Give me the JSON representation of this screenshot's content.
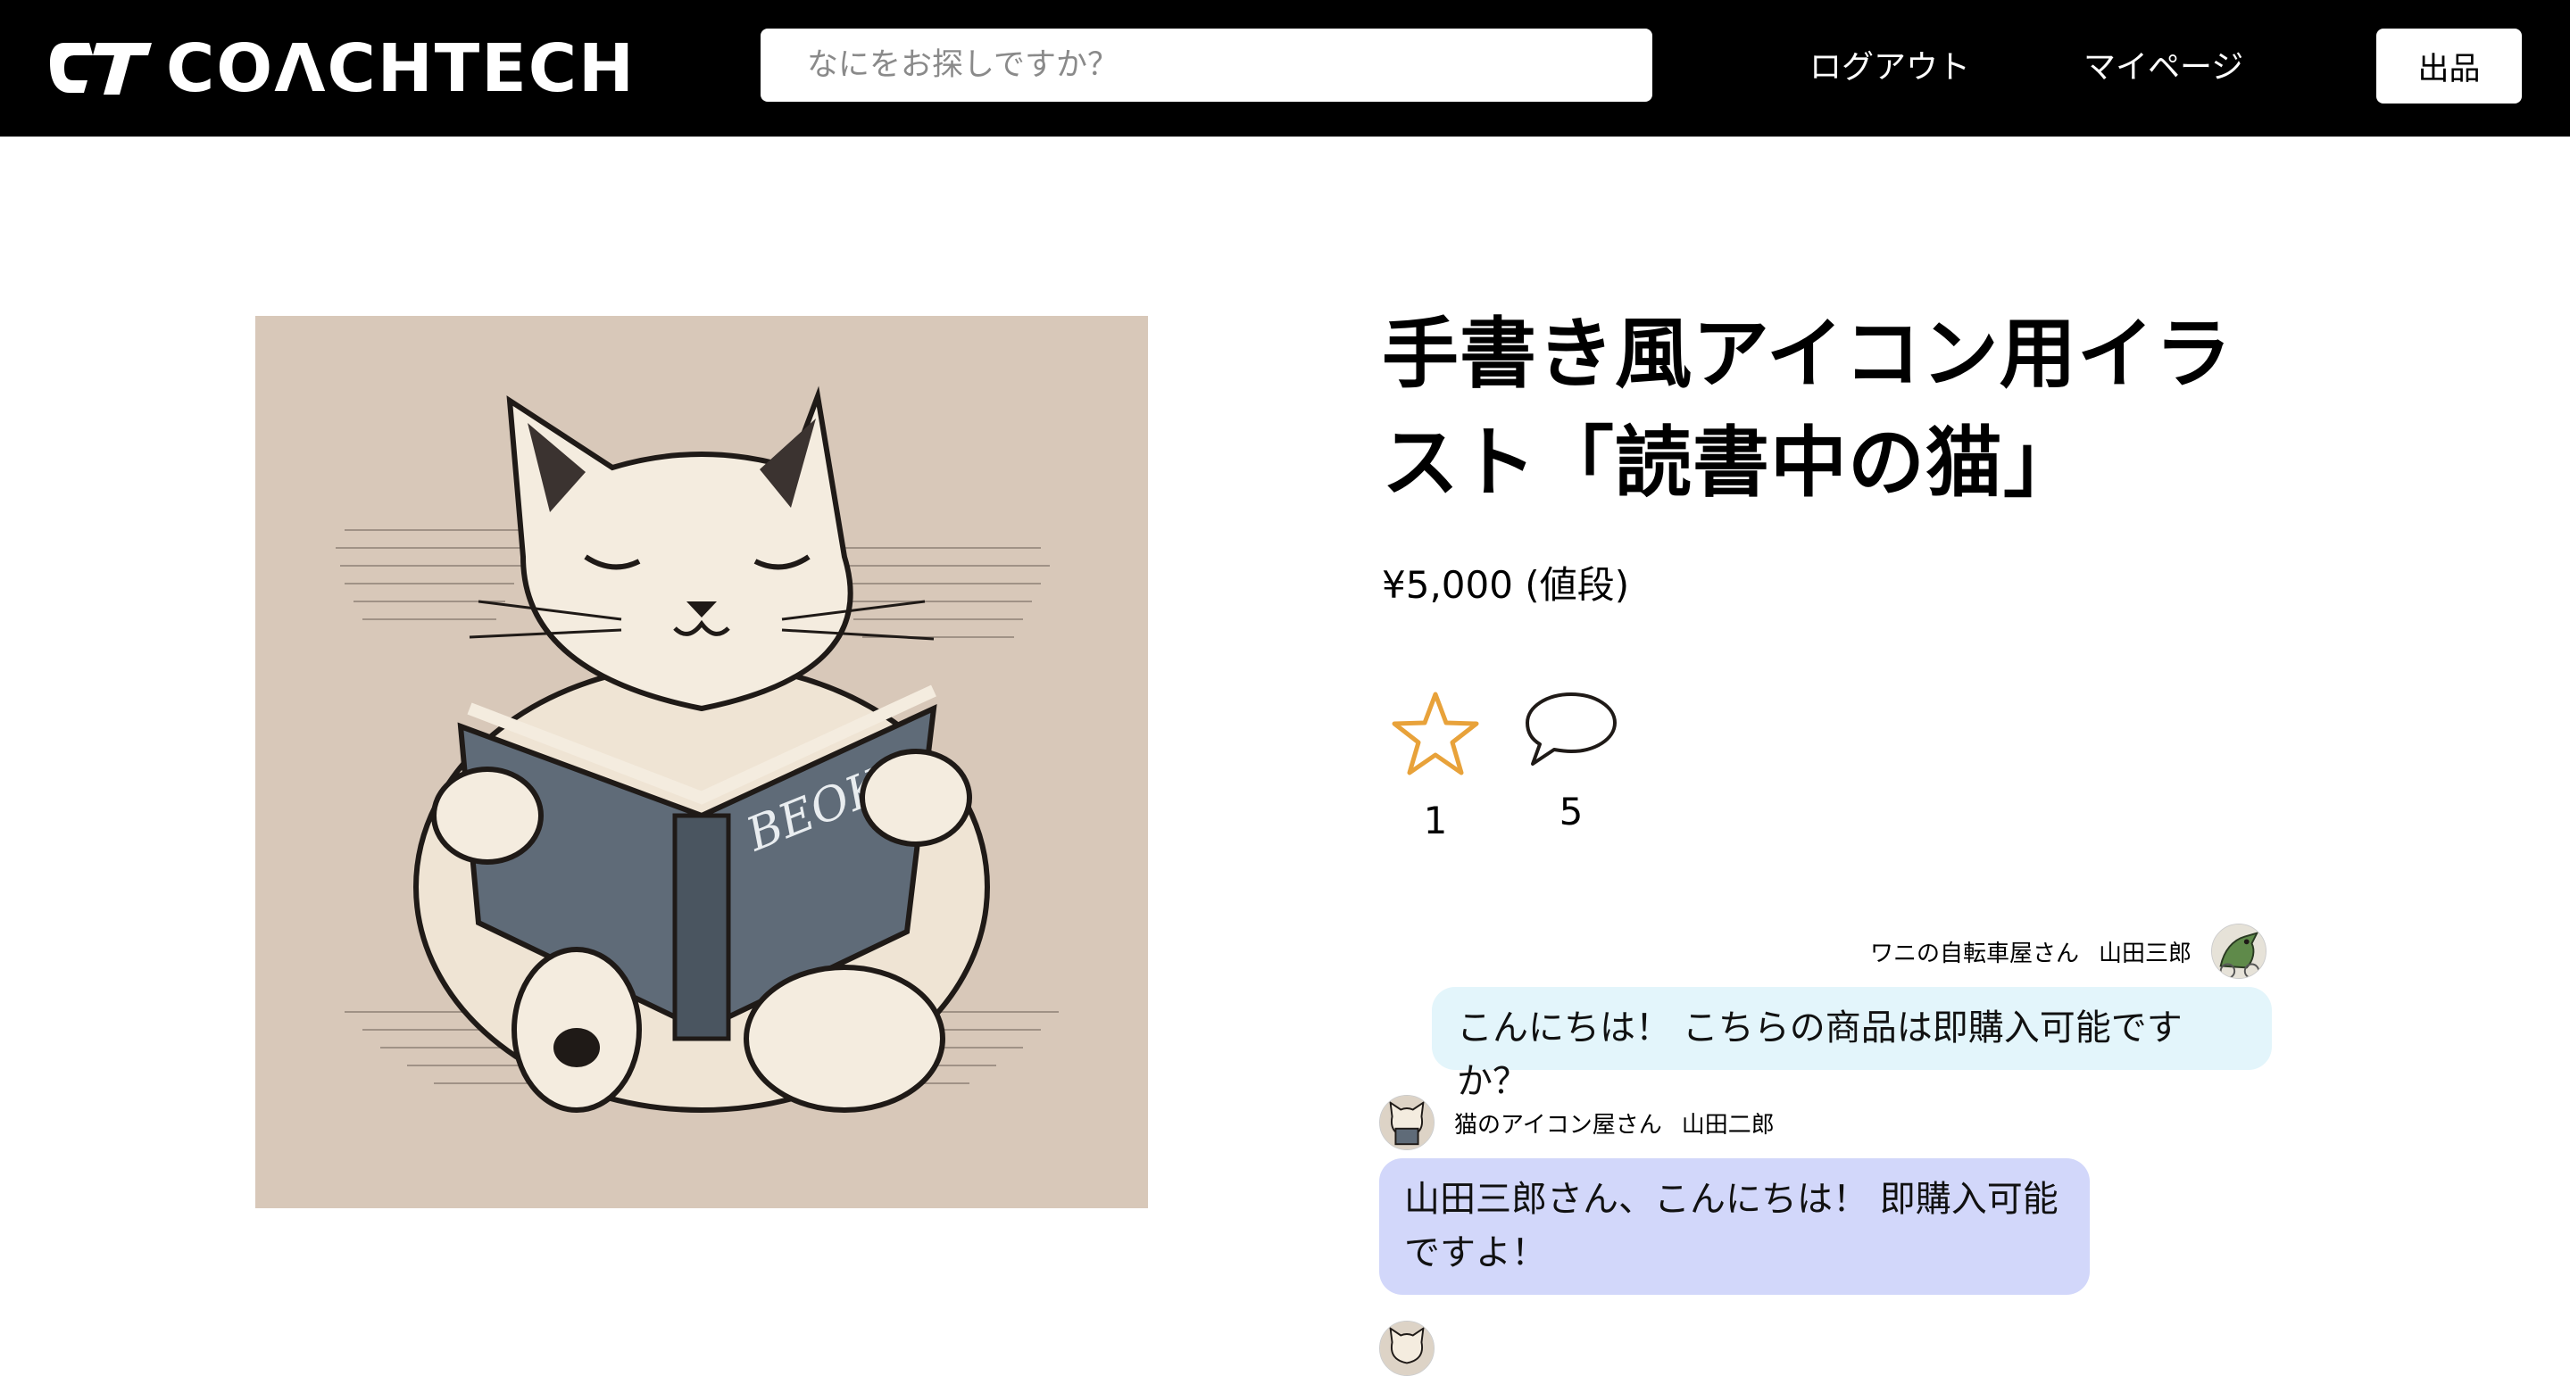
{
  "header": {
    "logo_text": "COΛCHTECH",
    "search_placeholder": "なにをお探しですか？",
    "logout_label": "ログアウト",
    "mypage_label": "マイページ",
    "sell_label": "出品"
  },
  "product": {
    "title": "手書き風アイコン用イラスト「読書中の猫」",
    "price": "¥5,000 (値段)",
    "image_book_text": "BEOK",
    "favorite_count": "1",
    "comment_count": "5"
  },
  "comments": [
    {
      "shop": "ワニの自転車屋さん",
      "user": "山田三郎",
      "avatar_icon": "crocodile-avatar",
      "text": "こんにちは！ こちらの商品は即購入可能ですか？"
    },
    {
      "shop": "猫のアイコン屋さん",
      "user": "山田二郎",
      "avatar_icon": "cat-avatar",
      "text": "山田三郎さん、こんにちは！ 即購入可能ですよ！"
    }
  ],
  "colors": {
    "header_bg": "#000000",
    "star": "#e8a23a",
    "bubble_other": "#e3f5fb",
    "bubble_owner": "#d2d7fa"
  }
}
